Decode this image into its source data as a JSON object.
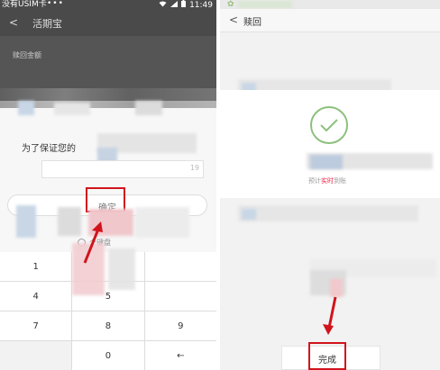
{
  "left": {
    "status": {
      "carrier": "没有USIM卡",
      "dots": "•••",
      "time": "11:49"
    },
    "header": {
      "back": "<",
      "title": "活期宝"
    },
    "body_label": "赎回金额",
    "prompt": "为了保证您的",
    "input_suffix": "19",
    "confirm_label": "确定",
    "keyboard_hint": "个键盘",
    "keys": [
      "1",
      "",
      "",
      "4",
      "5",
      "",
      "7",
      "8",
      "9",
      "",
      "0",
      "←"
    ]
  },
  "right": {
    "header": {
      "back": "<",
      "title": "赎回"
    },
    "estimate_prefix": "预计",
    "estimate_highlight": "实时",
    "estimate_suffix": "到账",
    "done_label": "完成"
  },
  "colors": {
    "highlight_box": "#d0141c",
    "success_green": "#8cc07d",
    "dim_overlay": "#4a4a4a"
  }
}
